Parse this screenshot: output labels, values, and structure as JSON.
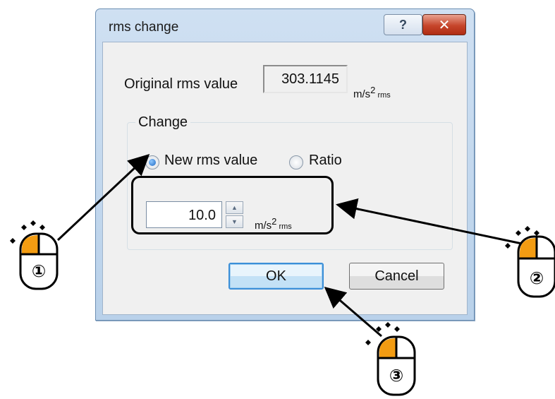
{
  "dialog": {
    "title": "rms change",
    "help_button": "?",
    "close_button": "✕"
  },
  "original": {
    "label": "Original rms value",
    "value": "303.1145",
    "unit_main": "m/s",
    "unit_exp": "2",
    "unit_sub": " rms"
  },
  "change": {
    "group_label": "Change",
    "radio_new_label": "New rms value",
    "radio_ratio_label": "Ratio",
    "selected": "New rms value",
    "input_value": "10.0",
    "unit_main": "m/s",
    "unit_exp": "2",
    "unit_sub": " rms"
  },
  "buttons": {
    "ok": "OK",
    "cancel": "Cancel"
  },
  "annotations": {
    "step1": "①",
    "step2": "②",
    "step3": "③",
    "accent_color": "#f39c12"
  },
  "icons": {
    "help": "question-mark-icon",
    "close": "close-icon",
    "spin_up": "arrow-up-icon",
    "spin_down": "arrow-down-icon",
    "mouse": "mouse-left-click-icon"
  }
}
